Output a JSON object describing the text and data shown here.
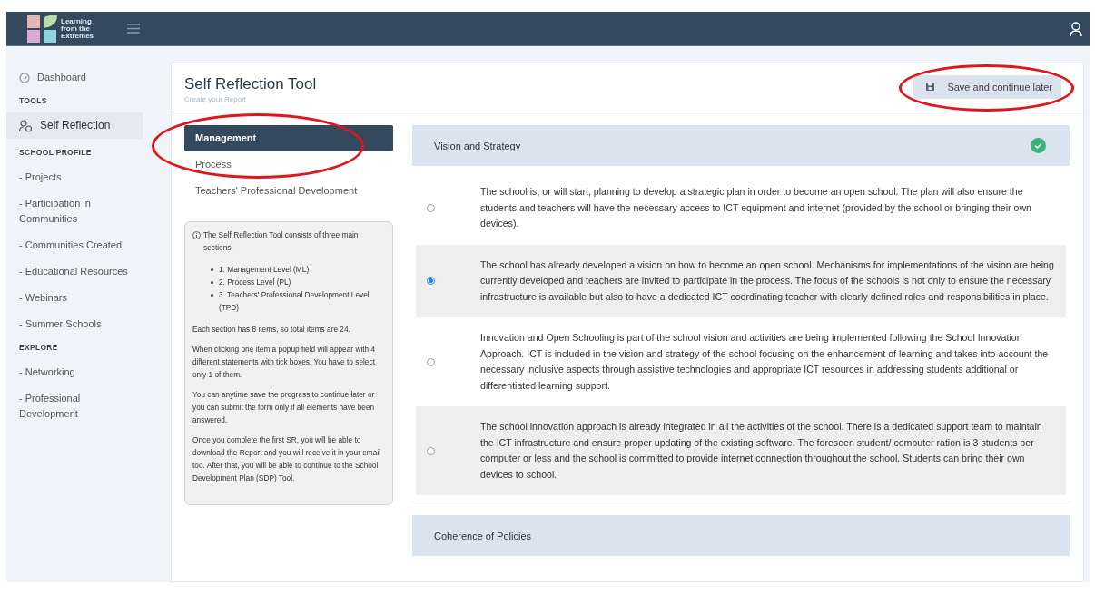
{
  "header": {
    "logo_text": "Learning from the Extremes"
  },
  "sidebar": {
    "groups": [
      {
        "items": [
          {
            "label": "Dashboard",
            "selected": false
          }
        ]
      },
      {
        "heading": "TOOLS",
        "items": [
          {
            "label": "Self Reflection",
            "selected": true
          }
        ]
      },
      {
        "heading": "SCHOOL PROFILE",
        "items": [
          {
            "label": "- Projects",
            "selected": false
          },
          {
            "label": "- Participation in Communities",
            "selected": false
          },
          {
            "label": "- Communities Created",
            "selected": false
          },
          {
            "label": "- Educational Resources",
            "selected": false
          },
          {
            "label": "- Webinars",
            "selected": false
          },
          {
            "label": "- Summer Schools",
            "selected": false
          }
        ]
      },
      {
        "heading": "EXPLORE",
        "items": [
          {
            "label": "- Networking",
            "selected": false
          },
          {
            "label": "- Professional Development",
            "selected": false
          }
        ]
      }
    ]
  },
  "page": {
    "title": "Self Reflection Tool",
    "subtitle": "Create your Report",
    "save_button": {
      "label": "Save and continue later",
      "circled": true
    }
  },
  "section_nav": {
    "circled": true,
    "items": [
      {
        "label": "Management",
        "selected": true
      },
      {
        "label": "Process",
        "selected": false
      },
      {
        "label": "Teachers' Professional Development",
        "selected": false
      }
    ]
  },
  "info_box": {
    "intro": "The Self Reflection Tool consists of three main sections:",
    "list": [
      "1. Management Level (ML)",
      "2. Process Level (PL)",
      "3. Teachers' Professional Development Level (TPD)"
    ],
    "paragraphs": [
      "Each section has 8 items, so total items are 24.",
      "When clicking one item a popup field will appear with 4 different statements with tick boxes. You have to select only 1 of them.",
      "You can anytime save the progress to continue later or you can submit the form only if all elements have been answered.",
      "Once you complete the first SR, you will be able to download the Report and you will receive it in your email too. After that, you will be able to continue to the School Development Plan (SDP) Tool."
    ]
  },
  "sections": [
    {
      "title": "Vision and Strategy",
      "completed": true,
      "options": [
        {
          "text": "The school is, or will start, planning to develop a strategic plan in order to become an open school. The plan will also ensure the students and teachers will have the necessary access to ICT equipment and internet (provided by the school or bringing their own devices).",
          "selected": false
        },
        {
          "text": "The school has already developed a vision on how to become an open school. Mechanisms for implementations of the vision are being currently developed and teachers are invited to participate in the process. The focus of the schools is not only to ensure the necessary infrastructure is available but also to have a dedicated ICT coordinating teacher with clearly defined roles and responsibilities in place.",
          "selected": true
        },
        {
          "text": "Innovation and Open Schooling is part of the school vision and activities are being implemented following the School Innovation Approach. ICT is included in the vision and strategy of the school focusing on the enhancement of learning and takes into account the necessary inclusive aspects through assistive technologies and appropriate ICT resources in addressing students additional or differentiated learning support.",
          "selected": false
        },
        {
          "text": "The school innovation approach is already integrated in all the activities of the school. There is a dedicated support team to maintain the ICT infrastructure and ensure proper updating of the existing software. The foreseen student/ computer ration is 3 students per computer or less and the school is committed to provide internet connection throughout the school. Students can bring their own devices to school.",
          "selected": false
        }
      ]
    },
    {
      "title": "Coherence of Policies",
      "completed": false
    }
  ]
}
